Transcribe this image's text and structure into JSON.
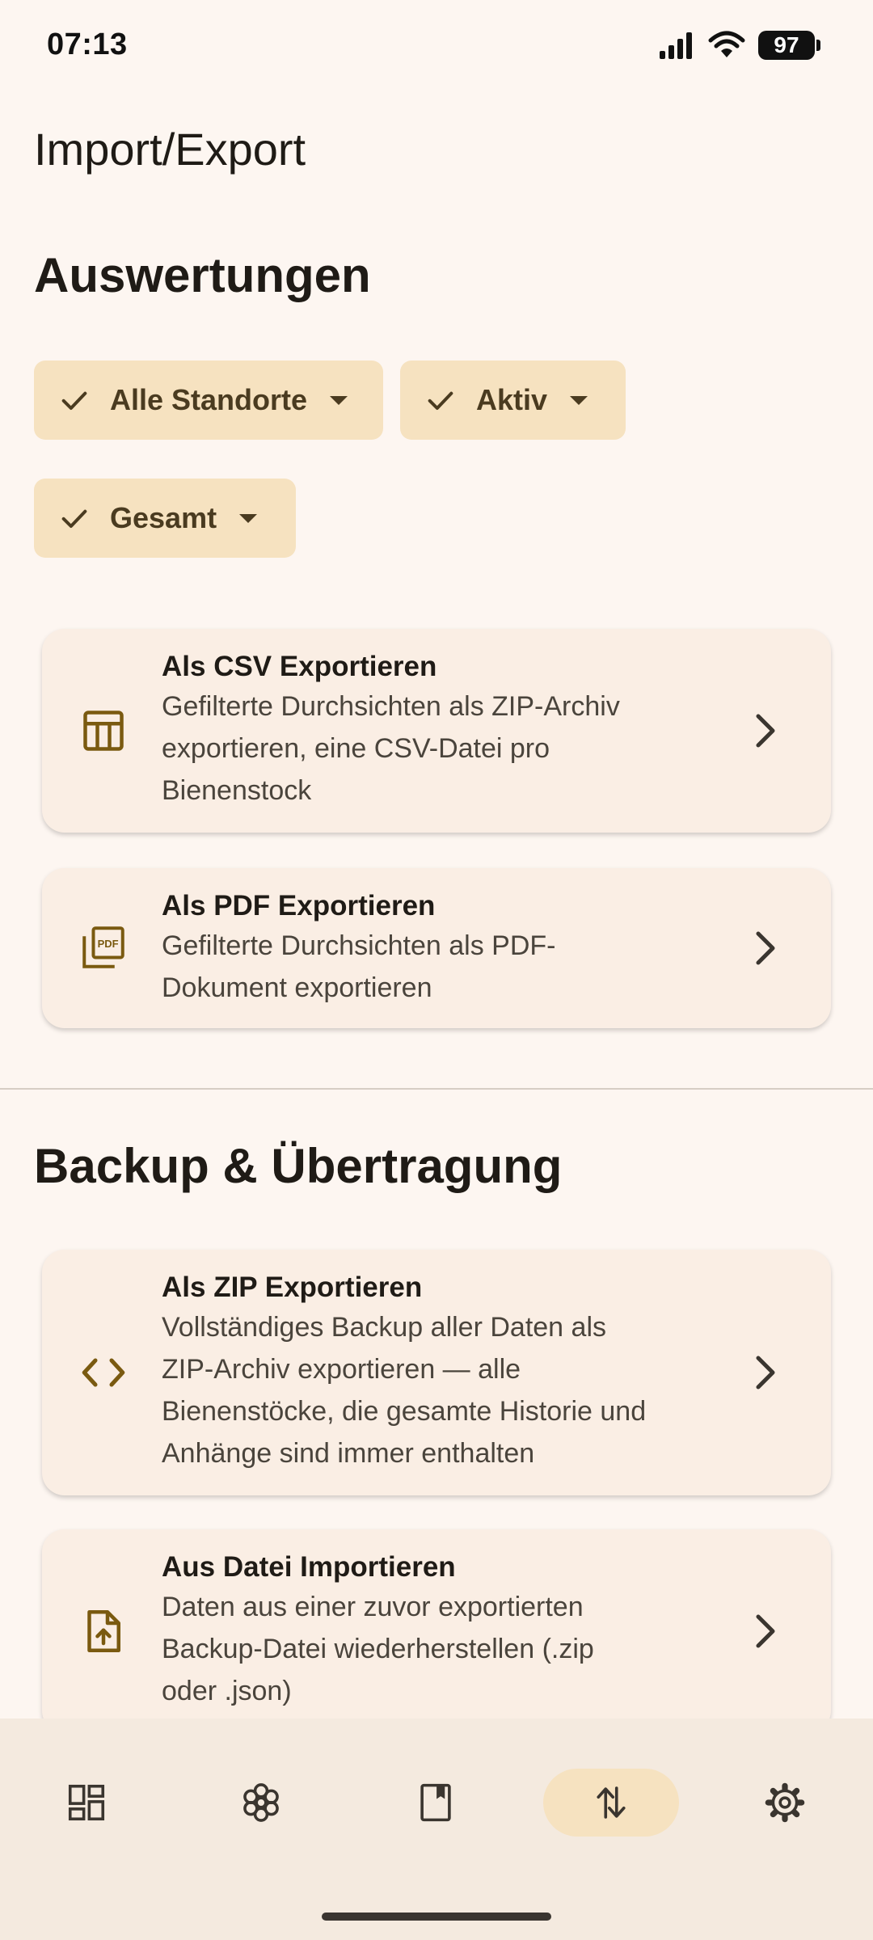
{
  "status": {
    "time": "07:13",
    "battery": "97"
  },
  "page": {
    "title": "Import/Export"
  },
  "sections": {
    "reports": "Auswertungen",
    "backup": "Backup & Übertragung"
  },
  "filters": [
    {
      "label": "Alle Standorte"
    },
    {
      "label": "Aktiv"
    },
    {
      "label": "Gesamt"
    }
  ],
  "cards": {
    "csv": {
      "title": "Als CSV Exportieren",
      "desc": [
        "Gefilterte Durchsichten als ZIP-Archiv",
        "exportieren, eine CSV-Datei pro",
        "Bienenstock"
      ]
    },
    "pdf": {
      "title": "Als PDF Exportieren",
      "desc": [
        "Gefilterte Durchsichten als PDF-",
        "Dokument exportieren"
      ],
      "icon_text": "PDF"
    },
    "zip": {
      "title": "Als ZIP Exportieren",
      "desc": [
        "Vollständiges Backup aller Daten als",
        "ZIP-Archiv exportieren — alle",
        "Bienenstöcke, die gesamte Historie und",
        "Anhänge sind immer enthalten"
      ]
    },
    "import": {
      "title": "Aus Datei Importieren",
      "desc": [
        "Daten aus einer zuvor exportierten",
        "Backup-Datei wiederherstellen (.zip",
        "oder .json)"
      ]
    }
  },
  "nav": {
    "items": [
      {
        "icon": "dashboard-icon"
      },
      {
        "icon": "flower-icon"
      },
      {
        "icon": "book-icon"
      },
      {
        "icon": "import-export-icon",
        "active": true
      },
      {
        "icon": "gear-icon"
      }
    ]
  },
  "colors": {
    "accent": "#f6e2c0",
    "icon": "#7a5a10",
    "background": "#fdf6f1"
  }
}
